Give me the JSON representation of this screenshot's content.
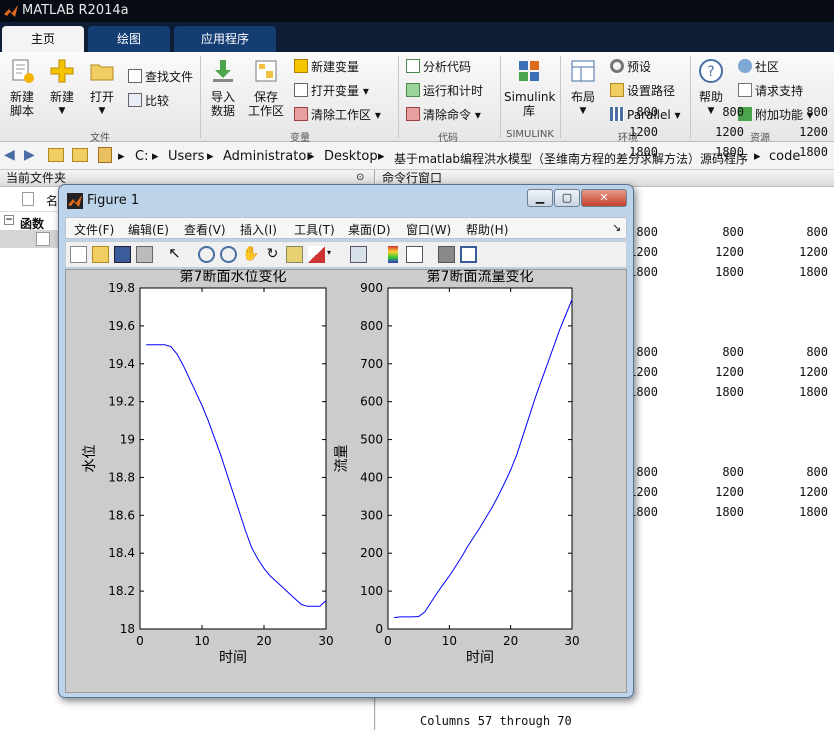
{
  "app": {
    "title": "MATLAB R2014a"
  },
  "tabs": [
    {
      "label": "主页"
    },
    {
      "label": "绘图"
    },
    {
      "label": "应用程序"
    }
  ],
  "ribbon": {
    "new_script": "新建\n脚本",
    "new": "新建",
    "open": "打开",
    "find_files": "查找文件",
    "compare": "比较",
    "import_data": "导入\n数据",
    "save_workspace": "保存\n工作区",
    "new_variable": "新建变量",
    "open_variable": "打开变量",
    "clear_workspace": "清除工作区",
    "analyze_code": "分析代码",
    "run_and_time": "运行和计时",
    "clear_commands": "清除命令",
    "simulink": "Simulink\n库",
    "layout": "布局",
    "preferences": "预设",
    "set_path": "设置路径",
    "parallel": "Parallel",
    "help": "帮助",
    "community": "社区",
    "request_support": "请求支持",
    "addons": "附加功能",
    "groups": {
      "file": "文件",
      "variable": "变量",
      "code": "代码",
      "simulink": "SIMULINK",
      "environment": "环境",
      "resources": "资源"
    }
  },
  "address": {
    "path": [
      "C:",
      "Users",
      "Administrator",
      "Desktop",
      "基于matlab编程洪水模型（圣维南方程的差分求解方法）源码程序",
      "code"
    ]
  },
  "left_panel": {
    "title": "当前文件夹",
    "column_header": "名",
    "section": "函数"
  },
  "command_window": {
    "title": "命令行窗口",
    "rows": [
      [
        "800",
        "800",
        "800"
      ],
      [
        "1200",
        "1200",
        "1200"
      ],
      [
        "1800",
        "1800",
        "1800"
      ],
      [
        "800",
        "800",
        "800"
      ],
      [
        "1200",
        "1200",
        "1200"
      ],
      [
        "1800",
        "1800",
        "1800"
      ],
      [
        "800",
        "800",
        "800"
      ],
      [
        "1200",
        "1200",
        "1200"
      ],
      [
        "1800",
        "1800",
        "1800"
      ],
      [
        "800",
        "800",
        "800"
      ],
      [
        "1200",
        "1200",
        "1200"
      ],
      [
        "1800",
        "1800",
        "1800"
      ]
    ],
    "footer": "Columns 57 through 70"
  },
  "figure": {
    "title": "Figure 1",
    "menu": [
      "文件(F)",
      "编辑(E)",
      "查看(V)",
      "插入(I)",
      "工具(T)",
      "桌面(D)",
      "窗口(W)",
      "帮助(H)"
    ],
    "toolbar_icons": [
      "new-figure-icon",
      "open-file-icon",
      "save-icon",
      "print-icon",
      "pointer-icon",
      "zoom-in-icon",
      "zoom-out-icon",
      "pan-icon",
      "rotate-icon",
      "data-cursor-icon",
      "brush-icon",
      "link-icon",
      "colorbar-icon",
      "legend-icon",
      "hide-plot-tools-icon",
      "show-plot-tools-icon"
    ]
  },
  "chart_data": [
    {
      "type": "line",
      "title": "第7断面水位变化",
      "xlabel": "时间",
      "ylabel": "水位",
      "xlim": [
        0,
        30
      ],
      "ylim": [
        18,
        19.8
      ],
      "xticks": [
        "0",
        "10",
        "20",
        "30"
      ],
      "yticks": [
        "18",
        "18.2",
        "18.4",
        "18.6",
        "18.8",
        "19",
        "19.2",
        "19.4",
        "19.6",
        "19.8"
      ],
      "line_color": "#0000ff",
      "x": [
        1,
        2,
        3,
        4,
        5,
        6,
        7,
        8,
        9,
        10,
        11,
        12,
        13,
        14,
        15,
        16,
        17,
        18,
        19,
        20,
        21,
        22,
        23,
        24,
        25,
        26,
        27,
        28,
        29,
        30
      ],
      "y": [
        19.5,
        19.5,
        19.5,
        19.5,
        19.49,
        19.45,
        19.39,
        19.32,
        19.25,
        19.18,
        19.1,
        19.01,
        18.92,
        18.82,
        18.72,
        18.62,
        18.52,
        18.43,
        18.37,
        18.32,
        18.28,
        18.25,
        18.22,
        18.19,
        18.16,
        18.13,
        18.12,
        18.12,
        18.12,
        18.15
      ]
    },
    {
      "type": "line",
      "title": "第7断面流量变化",
      "xlabel": "时间",
      "ylabel": "流量",
      "xlim": [
        0,
        30
      ],
      "ylim": [
        0,
        900
      ],
      "xticks": [
        "0",
        "10",
        "20",
        "30"
      ],
      "yticks": [
        "0",
        "100",
        "200",
        "300",
        "400",
        "500",
        "600",
        "700",
        "800",
        "900"
      ],
      "line_color": "#0000ff",
      "x": [
        1,
        2,
        3,
        4,
        5,
        6,
        7,
        8,
        9,
        10,
        11,
        12,
        13,
        14,
        15,
        16,
        17,
        18,
        19,
        20,
        21,
        22,
        23,
        24,
        25,
        26,
        27,
        28,
        29,
        30
      ],
      "y": [
        30,
        32,
        32,
        32,
        33,
        45,
        70,
        95,
        118,
        140,
        165,
        190,
        218,
        243,
        268,
        295,
        322,
        352,
        385,
        420,
        460,
        510,
        560,
        610,
        655,
        700,
        745,
        790,
        830,
        870
      ]
    }
  ]
}
